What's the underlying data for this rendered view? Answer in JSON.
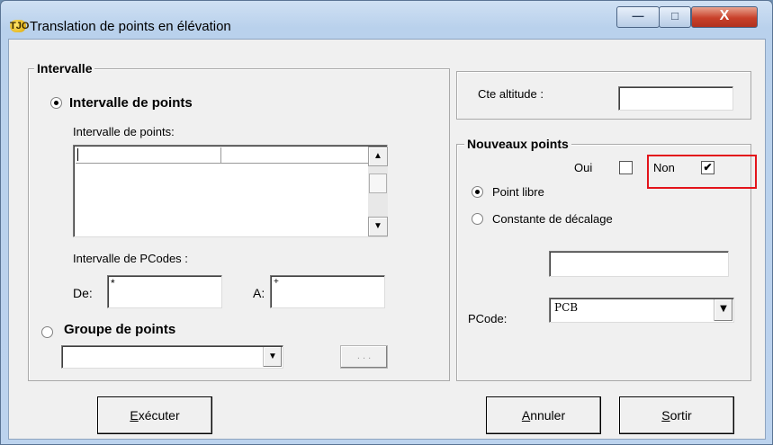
{
  "window": {
    "title": "Translation de points en élévation",
    "icon": "app-logo-icon",
    "icon_text": "TJO",
    "minimize_glyph": "—",
    "maximize_glyph": "□",
    "close_glyph": "X"
  },
  "intervalle_group": {
    "legend": "Intervalle",
    "radio_points_label": "Intervalle de points",
    "radio_points_selected": true,
    "points_list_label": "Intervalle de points:",
    "pcodes_label": "Intervalle de PCodes :",
    "de_label": "De:",
    "de_value": "*",
    "a_label": "A:",
    "a_value": "+",
    "radio_groupe_label": "Groupe de points",
    "radio_groupe_selected": false,
    "groupe_value": "",
    "ellipsis_label": ". . ."
  },
  "altitude": {
    "label": "Cte altitude :",
    "value": ""
  },
  "nouveaux_points": {
    "legend": "Nouveaux points",
    "oui_label": "Oui",
    "oui_checked": false,
    "non_label": "Non",
    "non_checked": true,
    "check_glyph": "✔",
    "radio_libre_label": "Point libre",
    "radio_libre_selected": true,
    "radio_constante_label": "Constante de décalage",
    "radio_constante_selected": false,
    "decalage_value": "",
    "pcode_label": "PCode:",
    "pcode_value": "PCB"
  },
  "buttons": {
    "executer_ul": "E",
    "executer_rest": "xécuter",
    "annuler_ul": "A",
    "annuler_rest": "nnuler",
    "sortir_ul": "S",
    "sortir_rest": "ortir"
  },
  "scroll": {
    "up": "▲",
    "down": "▼",
    "combo_down": "▼"
  },
  "colors": {
    "highlight": "#e3141b",
    "close_button": "#c8402a"
  }
}
